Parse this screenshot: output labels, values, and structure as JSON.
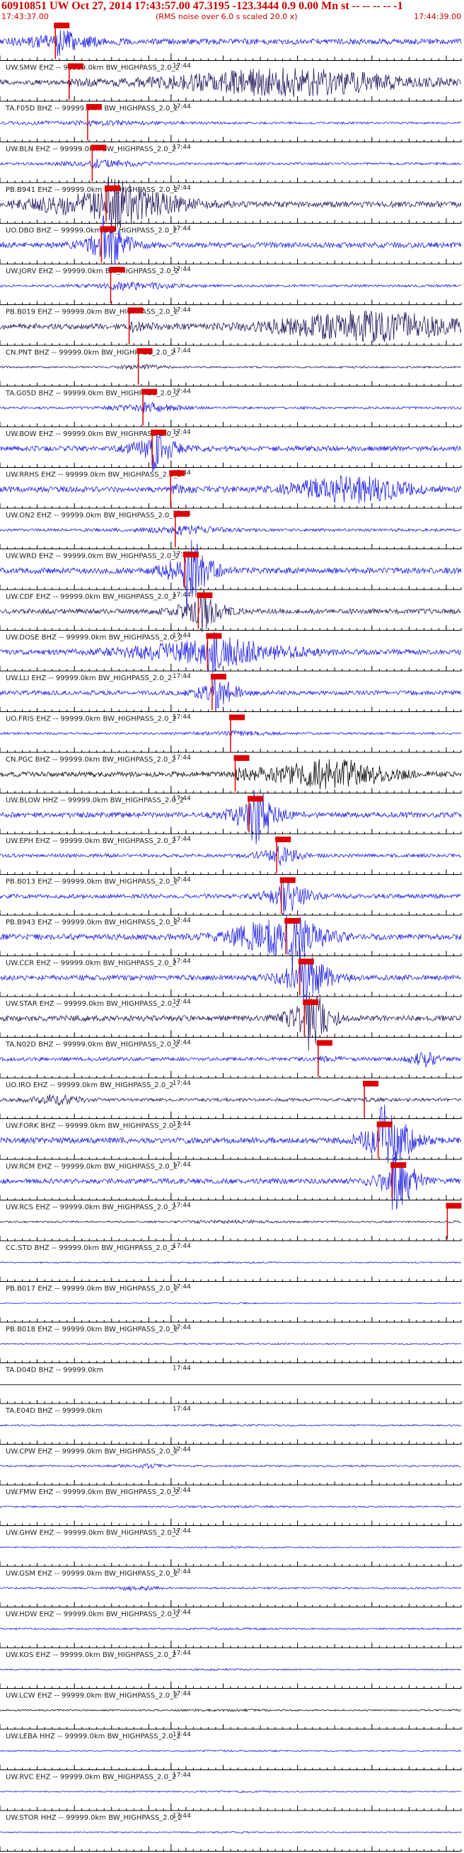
{
  "header": {
    "title": "60910851 UW Oct 27, 2014 17:43:57.00   47.3195 -123.3444  0.9 0.00 Mn st -- -- -- -- -1",
    "start_time": "17:43:37.00",
    "note": "(RMS noise over 6.0 s scaled 20.0 x)",
    "end_time": "17:44:39.00"
  },
  "colors": {
    "trace_blue": "#1f1fe6",
    "trace_dark": "#2a1a5e",
    "trace_black": "#111111",
    "pick": "#dd0000",
    "axis": "#000000"
  },
  "time_tick_label": "17:44",
  "chart_data": {
    "type": "seismogram",
    "title": "60910851 UW Oct 27, 2014 17:43:57.00   47.3195 -123.3444  0.9 0.00 Mn st -- -- -- -- -1",
    "x_range": [
      "17:43:37.00",
      "17:44:39.00"
    ],
    "traces": [
      {
        "label": "",
        "color": "blue",
        "pick": 0.12,
        "energy": [
          0.12,
          0.1,
          0.25
        ],
        "amp": 0.9
      },
      {
        "label": "UW.SMW EHZ -- 99999.0km BW_HIGHPASS_2.0_2",
        "color": "dark",
        "pick": 0.15,
        "energy": [
          0.62,
          0.25,
          0.9
        ],
        "amp": 0.8
      },
      {
        "label": "TA.F05D BHZ -- 99999.0km BW_HIGHPASS_2.0_2",
        "color": "blue",
        "pick": 0.19,
        "energy": [
          0.2,
          0.2,
          0.2
        ],
        "amp": 0.35
      },
      {
        "label": "UW.BLN EHZ -- 99999.0km BW_HIGHPASS_2.0_2",
        "color": "blue",
        "pick": 0.2,
        "energy": [
          0.22,
          0.1,
          0.3
        ],
        "amp": 0.4
      },
      {
        "label": "PB.B941 EHZ -- 99999.0km BW_HIGHPASS_2.0_2",
        "color": "dark",
        "pick": 0.23,
        "energy": [
          0.24,
          0.15,
          0.8
        ],
        "amp": 0.95
      },
      {
        "label": "UO.DBO BHZ -- 99999.0km BW_HIGHPASS_2.0_2",
        "color": "blue",
        "pick": 0.22,
        "energy": [
          0.23,
          0.05,
          0.75
        ],
        "amp": 0.9
      },
      {
        "label": "UW.JORV EHZ -- 99999.0km BW_HIGHPASS_2.0_2",
        "color": "blue",
        "pick": 0.24,
        "energy": [
          0.3,
          0.1,
          0.35
        ],
        "amp": 0.4
      },
      {
        "label": "PB.B019 EHZ -- 99999.0km BW_HIGHPASS_2.0_2",
        "color": "dark",
        "pick": 0.28,
        "energy": [
          0.8,
          0.2,
          0.9
        ],
        "amp": 0.9
      },
      {
        "label": "CN.PNT BHZ -- 99999.0km BW_HIGHPASS_2.0_2",
        "color": "dark",
        "pick": 0.3,
        "energy": [
          0.3,
          0.05,
          0.3
        ],
        "amp": 0.3
      },
      {
        "label": "TA.G05D BHZ -- 99999.0km BW_HIGHPASS_2.0_2",
        "color": "blue",
        "pick": 0.31,
        "energy": [
          0.32,
          0.08,
          0.4
        ],
        "amp": 0.4
      },
      {
        "label": "UW.BOW EHZ -- 99999.0km BW_HIGHPASS_2.0_2",
        "color": "blue",
        "pick": 0.33,
        "energy": [
          0.33,
          0.05,
          0.5
        ],
        "amp": 0.85
      },
      {
        "label": "UW.RRHS EHZ -- 99999.0km BW_HIGHPASS_2.0_2",
        "color": "blue",
        "pick": 0.37,
        "energy": [
          0.76,
          0.12,
          0.8
        ],
        "amp": 0.9
      },
      {
        "label": "UW.ON2 EHZ -- 99999.0km BW_HIGHPASS_2.0_2",
        "color": "blue",
        "pick": 0.38,
        "energy": [
          0.4,
          0.1,
          0.3
        ],
        "amp": 0.45
      },
      {
        "label": "UW.WRD EHZ -- 99999.0km BW_HIGHPASS_2.0_2",
        "color": "blue",
        "pick": 0.4,
        "energy": [
          0.41,
          0.05,
          0.95
        ],
        "amp": 0.95
      },
      {
        "label": "UW.CDF EHZ -- 99999.0km BW_HIGHPASS_2.0_2",
        "color": "dark",
        "pick": 0.43,
        "energy": [
          0.43,
          0.05,
          0.7
        ],
        "amp": 0.8
      },
      {
        "label": "UW.DOSE BHZ -- 99999.0km BW_HIGHPASS_2.0_2",
        "color": "blue",
        "pick": 0.45,
        "energy": [
          0.46,
          0.18,
          0.7
        ],
        "amp": 0.8
      },
      {
        "label": "UW.LLI EHZ -- 99999.0km BW_HIGHPASS_2.0_2",
        "color": "blue",
        "pick": 0.46,
        "energy": [
          0.47,
          0.05,
          0.6
        ],
        "amp": 0.7
      },
      {
        "label": "UO.FRIS EHZ -- 99999.0km BW_HIGHPASS_2.0_2",
        "color": "blue",
        "pick": 0.5,
        "energy": [
          0.5,
          0.1,
          0.2
        ],
        "amp": 0.35
      },
      {
        "label": "CN.PGC BHZ -- 99999.0km BW_HIGHPASS_2.0_2",
        "color": "black",
        "pick": 0.51,
        "energy": [
          0.72,
          0.12,
          0.9
        ],
        "amp": 0.85
      },
      {
        "label": "UW.BLOW HHZ -- 99999.0km BW_HIGHPASS_2.0_2",
        "color": "blue",
        "pick": 0.54,
        "energy": [
          0.55,
          0.05,
          0.9
        ],
        "amp": 0.9
      },
      {
        "label": "UW.EPH EHZ -- 99999.0km BW_HIGHPASS_2.0_2",
        "color": "blue",
        "pick": 0.6,
        "energy": [
          0.6,
          0.05,
          0.5
        ],
        "amp": 0.55
      },
      {
        "label": "PB.B013 EHZ -- 99999.0km BW_HIGHPASS_2.0_2",
        "color": "blue",
        "pick": 0.61,
        "energy": [
          0.62,
          0.05,
          0.7
        ],
        "amp": 0.7
      },
      {
        "label": "PB.B943 EHZ -- 99999.0km BW_HIGHPASS_2.0_2",
        "color": "blue",
        "pick": 0.62,
        "energy": [
          0.6,
          0.1,
          0.95
        ],
        "amp": 0.95
      },
      {
        "label": "UW.CCR EHZ -- 99999.0km BW_HIGHPASS_2.0_2",
        "color": "blue",
        "pick": 0.65,
        "energy": [
          0.66,
          0.06,
          0.8
        ],
        "amp": 0.85
      },
      {
        "label": "UW.STAR EHZ -- 99999.0km BW_HIGHPASS_2.0_2",
        "color": "dark",
        "pick": 0.66,
        "energy": [
          0.67,
          0.05,
          0.85
        ],
        "amp": 0.9
      },
      {
        "label": "TA.N02D BHZ -- 99999.0km BW_HIGHPASS_2.0_2",
        "color": "blue",
        "pick": 0.69,
        "energy": [
          0.92,
          0.03,
          0.6
        ],
        "amp": 0.6
      },
      {
        "label": "UO.IRO EHZ -- 99999.0km BW_HIGHPASS_2.0_2",
        "color": "dark",
        "pick": 0.79,
        "energy": [
          0.12,
          0.06,
          0.5
        ],
        "amp": 0.5
      },
      {
        "label": "UW.FORK BHZ -- 99999.0km BW_HIGHPASS_2.0_2",
        "color": "blue",
        "pick": 0.82,
        "energy": [
          0.84,
          0.06,
          0.9
        ],
        "amp": 0.95
      },
      {
        "label": "UW.RCM EHZ -- 99999.0km BW_HIGHPASS_2.0_2",
        "color": "blue",
        "pick": 0.85,
        "energy": [
          0.86,
          0.05,
          0.8
        ],
        "amp": 0.85
      },
      {
        "label": "UW.RCS EHZ -- 99999.0km BW_HIGHPASS_2.0_2",
        "color": "dark",
        "pick": 0.97,
        "energy": [
          0.5,
          0.1,
          0.2
        ],
        "amp": 0.3
      },
      {
        "label": "CC.STD BHZ -- 99999.0km BW_HIGHPASS_2.0_2",
        "color": "blue",
        "pick": null,
        "energy": [
          0.5,
          0.1,
          0.1
        ],
        "amp": 0.2
      },
      {
        "label": "PB.B017 EHZ -- 99999.0km BW_HIGHPASS_2.0_2",
        "color": "blue",
        "pick": null,
        "energy": [
          0.5,
          0.1,
          0.1
        ],
        "amp": 0.15
      },
      {
        "label": "PB.B018 EHZ -- 99999.0km BW_HIGHPASS_2.0_2",
        "color": "blue",
        "pick": null,
        "energy": [
          0.5,
          0.1,
          0.1
        ],
        "amp": 0.2
      },
      {
        "label": "TA.D04D BHZ -- 99999.0km",
        "color": "flat",
        "pick": null,
        "energy": [
          0.5,
          0.1,
          0.0
        ],
        "amp": 0.0
      },
      {
        "label": "TA.E04D BHZ -- 99999.0km",
        "color": "blue",
        "pick": null,
        "energy": [
          0.5,
          0.1,
          0.1
        ],
        "amp": 0.25
      },
      {
        "label": "UW.CPW EHZ -- 99999.0km BW_HIGHPASS_2.0_2",
        "color": "blue",
        "pick": null,
        "energy": [
          0.32,
          0.05,
          0.3
        ],
        "amp": 0.3
      },
      {
        "label": "UW.FMW EHZ -- 99999.0km BW_HIGHPASS_2.0_2",
        "color": "blue",
        "pick": null,
        "energy": [
          0.5,
          0.1,
          0.1
        ],
        "amp": 0.25
      },
      {
        "label": "UW.GHW EHZ -- 99999.0km BW_HIGHPASS_2.0_2",
        "color": "blue",
        "pick": null,
        "energy": [
          0.5,
          0.1,
          0.1
        ],
        "amp": 0.2
      },
      {
        "label": "UW.GSM EHZ -- 99999.0km BW_HIGHPASS_2.0_2",
        "color": "blue",
        "pick": null,
        "energy": [
          0.3,
          0.05,
          0.3
        ],
        "amp": 0.3
      },
      {
        "label": "UW.HDW EHZ -- 99999.0km BW_HIGHPASS_2.0_2",
        "color": "blue",
        "pick": null,
        "energy": [
          0.5,
          0.1,
          0.1
        ],
        "amp": 0.25
      },
      {
        "label": "UW.KOS EHZ -- 99999.0km BW_HIGHPASS_2.0_2",
        "color": "blue",
        "pick": null,
        "energy": [
          0.5,
          0.1,
          0.1
        ],
        "amp": 0.2
      },
      {
        "label": "UW.LCW EHZ -- 99999.0km BW_HIGHPASS_2.0_2",
        "color": "black",
        "pick": null,
        "energy": [
          0.5,
          0.1,
          0.1
        ],
        "amp": 0.25
      },
      {
        "label": "UW.LEBA HHZ -- 99999.0km BW_HIGHPASS_2.0_2",
        "color": "blue",
        "pick": null,
        "energy": [
          0.5,
          0.1,
          0.1
        ],
        "amp": 0.2
      },
      {
        "label": "UW.RVC EHZ -- 99999.0km BW_HIGHPASS_2.0_2",
        "color": "blue",
        "pick": null,
        "energy": [
          0.5,
          0.1,
          0.1
        ],
        "amp": 0.2
      },
      {
        "label": "UW.STOR HHZ -- 99999.0km BW_HIGHPASS_2.0_2",
        "color": "blue",
        "pick": null,
        "energy": [
          0.5,
          0.1,
          0.1
        ],
        "amp": 0.2
      }
    ]
  }
}
